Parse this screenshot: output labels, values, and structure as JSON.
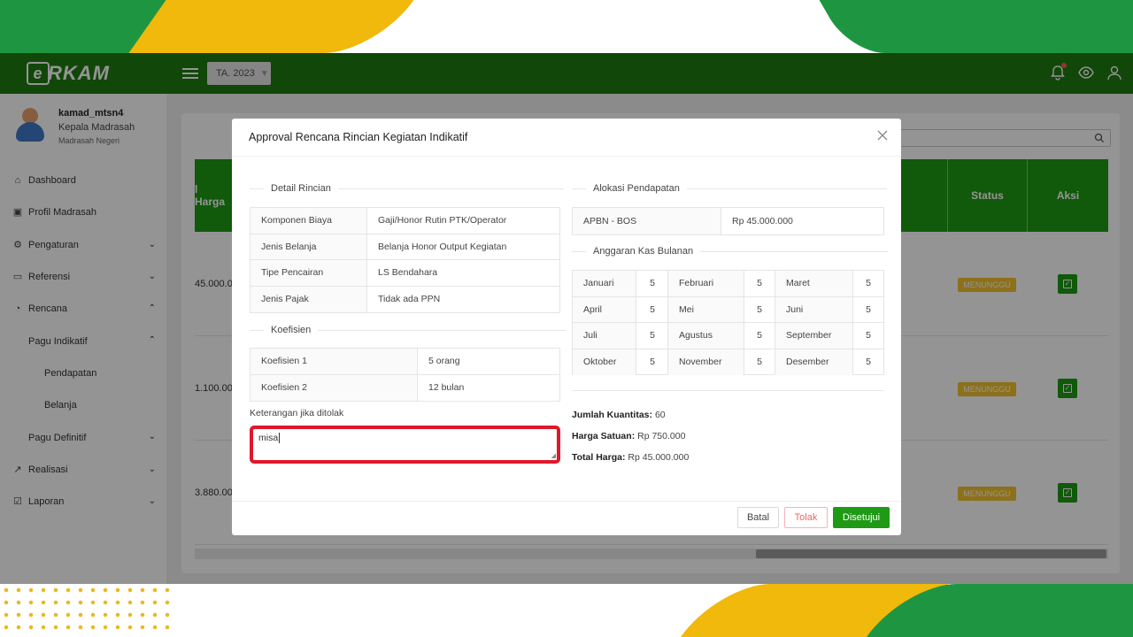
{
  "app": {
    "logo_text": "RKAM",
    "logo_letter": "e",
    "year_select": "TA. 2023"
  },
  "user": {
    "name": "kamad_mtsn4",
    "role": "Kepala Madrasah",
    "institution": "Madrasah Negeri"
  },
  "sidebar": {
    "items": [
      {
        "label": "Dashboard",
        "icon": "home-icon"
      },
      {
        "label": "Profil Madrasah",
        "icon": "id-card-icon"
      },
      {
        "label": "Pengaturan",
        "icon": "gear-icon"
      },
      {
        "label": "Referensi",
        "icon": "folder-icon"
      },
      {
        "label": "Rencana",
        "icon": "pie-chart-icon"
      },
      {
        "label": "Pagu Indikatif"
      },
      {
        "label": "Pendapatan"
      },
      {
        "label": "Belanja"
      },
      {
        "label": "Pagu Definitif"
      },
      {
        "label": "Realisasi",
        "icon": "trend-icon"
      },
      {
        "label": "Laporan",
        "icon": "report-icon"
      }
    ]
  },
  "table": {
    "headers": {
      "harga": "l Harga",
      "status": "Status",
      "aksi": "Aksi"
    },
    "rows": [
      {
        "harga": "45.000.00",
        "status": "MENUNGGU"
      },
      {
        "harga": "1.100.00",
        "status": "MENUNGGU"
      },
      {
        "harga": "3.880.00",
        "status": "MENUNGGU"
      }
    ]
  },
  "modal": {
    "title": "Approval Rencana Rincian Kegiatan Indikatif",
    "detail_title": "Detail Rincian",
    "detail": [
      {
        "k": "Komponen Biaya",
        "v": "Gaji/Honor Rutin PTK/Operator"
      },
      {
        "k": "Jenis Belanja",
        "v": "Belanja Honor Output Kegiatan"
      },
      {
        "k": "Tipe Pencairan",
        "v": "LS Bendahara"
      },
      {
        "k": "Jenis Pajak",
        "v": "Tidak ada PPN"
      }
    ],
    "koef_title": "Koefisien",
    "koef": [
      {
        "k": "Koefisien 1",
        "v": "5 orang"
      },
      {
        "k": "Koefisien 2",
        "v": "12 bulan"
      }
    ],
    "ket_label": "Keterangan jika ditolak",
    "ket_value": "misa",
    "alokasi_title": "Alokasi Pendapatan",
    "alokasi": {
      "k": "APBN - BOS",
      "v": "Rp 45.000.000"
    },
    "anggaran_title": "Anggaran Kas Bulanan",
    "months": [
      [
        {
          "m": "Januari",
          "v": "5"
        },
        {
          "m": "Februari",
          "v": "5"
        },
        {
          "m": "Maret",
          "v": "5"
        }
      ],
      [
        {
          "m": "April",
          "v": "5"
        },
        {
          "m": "Mei",
          "v": "5"
        },
        {
          "m": "Juni",
          "v": "5"
        }
      ],
      [
        {
          "m": "Juli",
          "v": "5"
        },
        {
          "m": "Agustus",
          "v": "5"
        },
        {
          "m": "September",
          "v": "5"
        }
      ],
      [
        {
          "m": "Oktober",
          "v": "5"
        },
        {
          "m": "November",
          "v": "5"
        },
        {
          "m": "Desember",
          "v": "5"
        }
      ]
    ],
    "summary": {
      "qty_label": "Jumlah Kuantitas",
      "qty_value": "60",
      "unit_label": "Harga Satuan",
      "unit_value": "Rp 750.000",
      "total_label": "Total Harga",
      "total_value": "Rp 45.000.000"
    },
    "buttons": {
      "batal": "Batal",
      "tolak": "Tolak",
      "setuju": "Disetujui"
    }
  },
  "colors": {
    "brand_green": "#1e7a10",
    "accent_green": "#1e9a14",
    "status_yellow": "#f2c230",
    "highlight_red": "#e0182a"
  }
}
